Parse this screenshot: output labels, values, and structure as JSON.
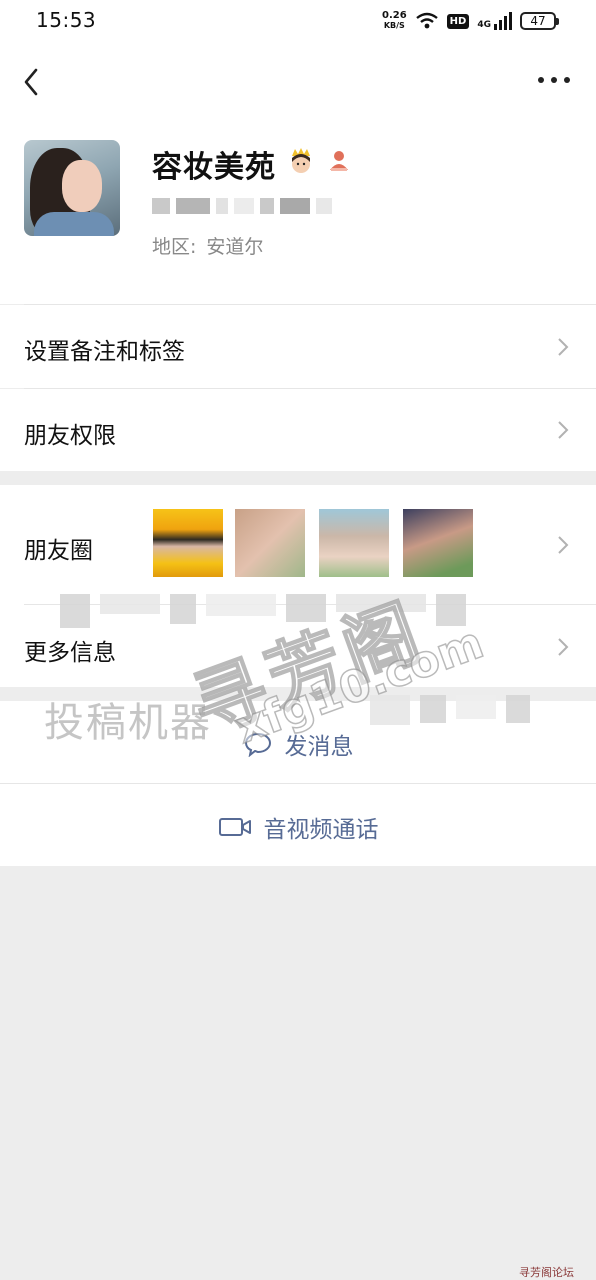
{
  "status_bar": {
    "time": "15:53",
    "net_speed_value": "0.26",
    "net_speed_unit": "KB/S",
    "hd": "HD",
    "network": "4G",
    "battery": "47"
  },
  "profile": {
    "nickname": "容妆美苑",
    "region_label": "地区:",
    "region_value": "安道尔"
  },
  "menu": {
    "remark_tags": "设置备注和标签",
    "friend_permissions": "朋友权限",
    "moments": "朋友圈",
    "more_info": "更多信息"
  },
  "actions": {
    "send_message": "发消息",
    "av_call": "音视频通话"
  },
  "watermark": {
    "contribute": "投稿机器",
    "site_name": "寻芳阁",
    "site_url": "xfg10.com",
    "corner": "寻芳阁论坛"
  },
  "colors": {
    "link_blue": "#576b95",
    "bg_gray": "#ededed"
  }
}
